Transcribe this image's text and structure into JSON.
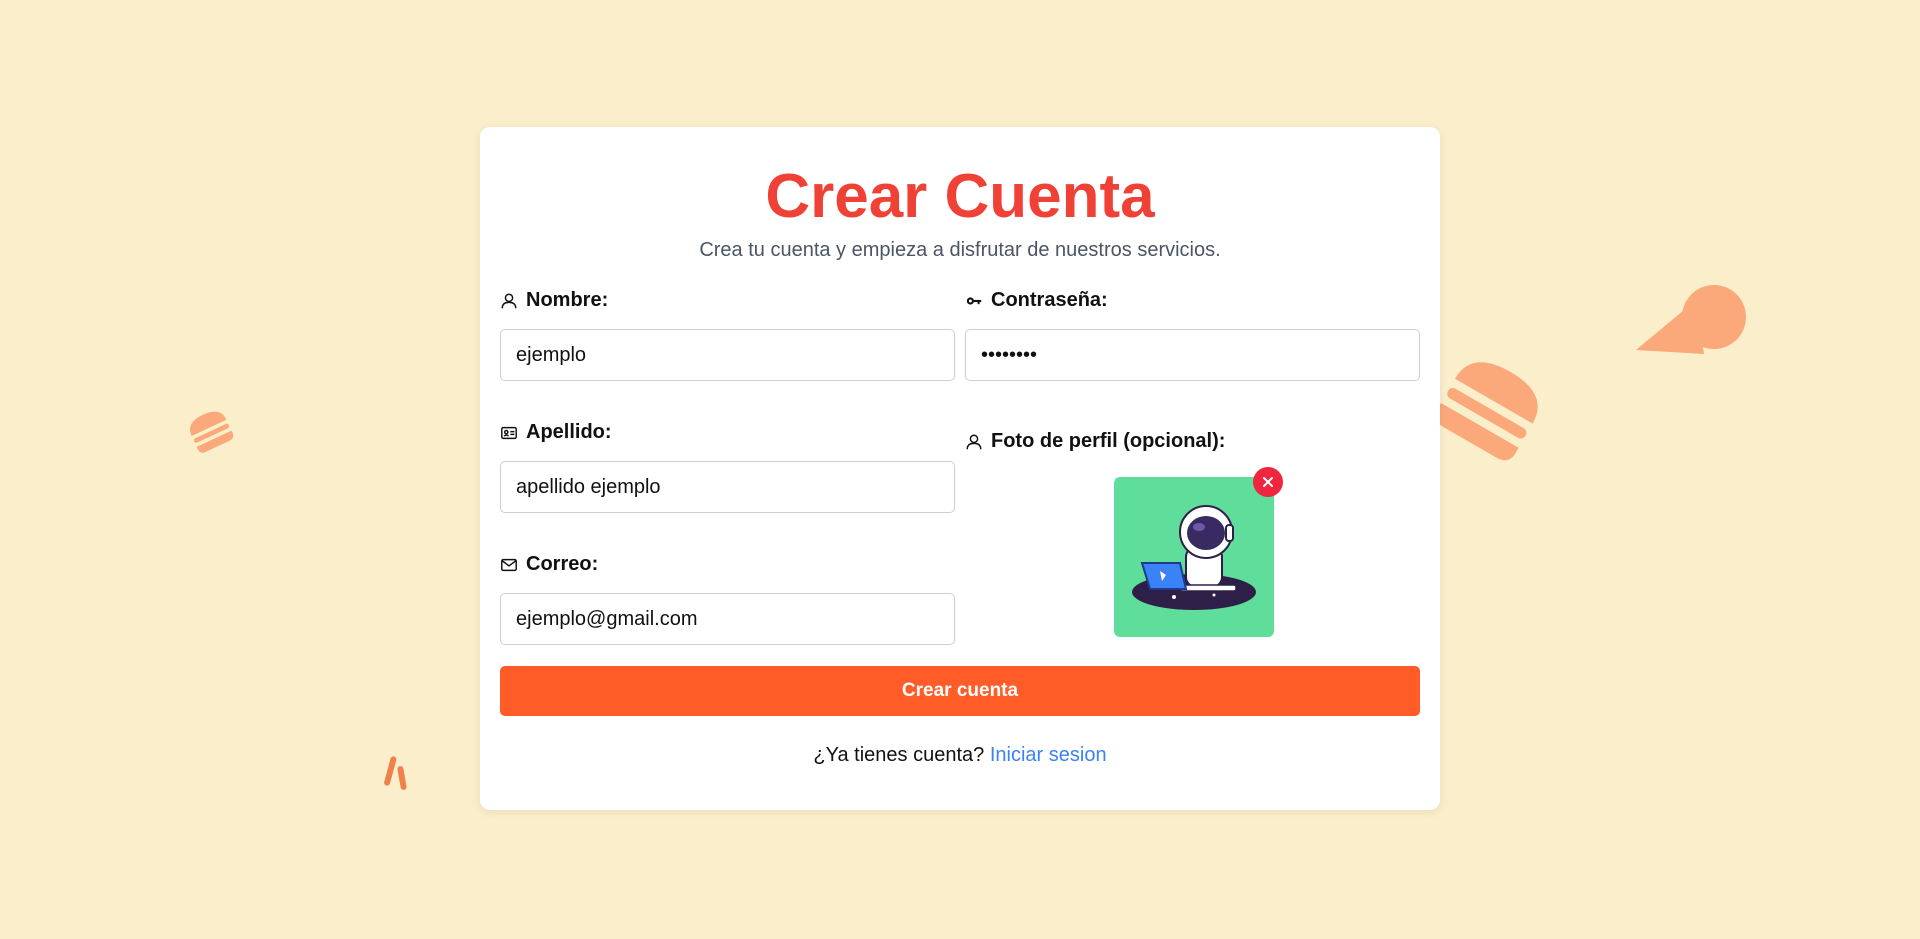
{
  "card": {
    "title": "Crear Cuenta",
    "subtitle": "Crea tu cuenta y empieza a disfrutar de nuestros servicios."
  },
  "fields": {
    "nombre": {
      "label": "Nombre:",
      "value": "ejemplo",
      "icon": "user-icon"
    },
    "apellido": {
      "label": "Apellido:",
      "value": "apellido ejemplo",
      "icon": "id-card-icon"
    },
    "correo": {
      "label": "Correo:",
      "value": "ejemplo@gmail.com",
      "icon": "mail-icon"
    },
    "contrasena": {
      "label": "Contraseña:",
      "value": "••••••••",
      "icon": "key-icon"
    },
    "foto": {
      "label": "Foto de perfil (opcional):",
      "icon": "user-icon"
    }
  },
  "submit_label": "Crear cuenta",
  "footer": {
    "text": "¿Ya tienes cuenta?",
    "link": "Iniciar sesion"
  },
  "colors": {
    "background": "#faeecb",
    "title": "#ef4136",
    "button": "#ff5c28",
    "link": "#3b82f6",
    "decoration": "#fba97a",
    "avatar_bg": "#5fdd9a",
    "remove": "#f0263f"
  },
  "decorations": [
    "burger-icon",
    "ice-cream-icon",
    "fork-icon"
  ]
}
